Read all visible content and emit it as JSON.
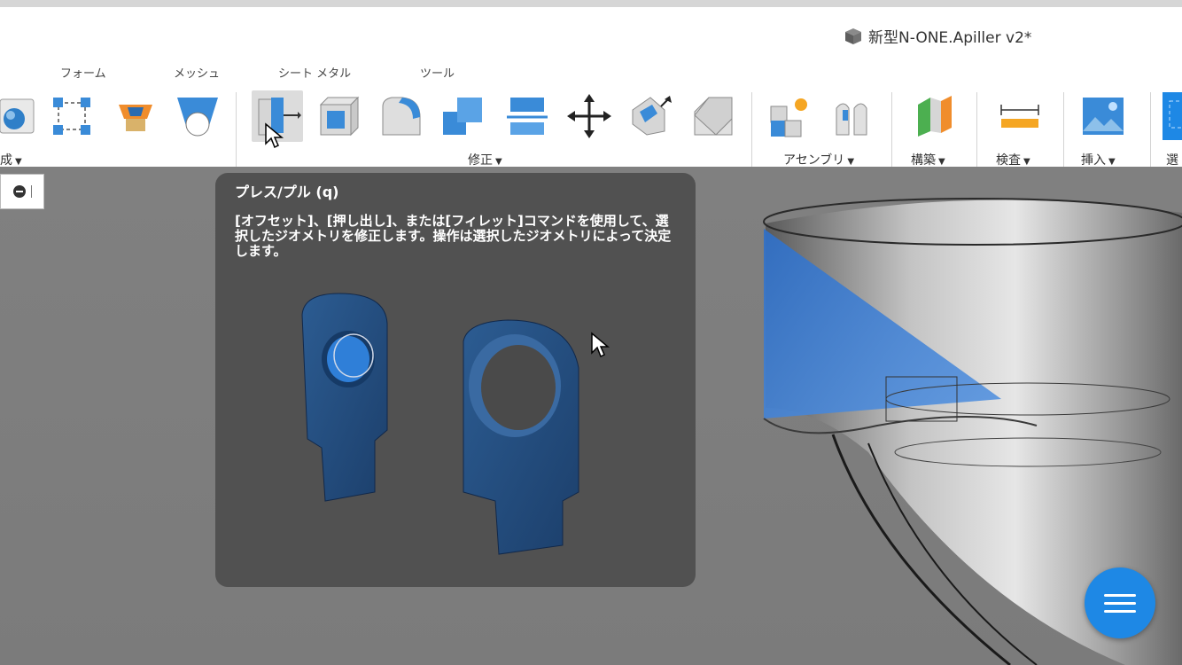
{
  "title_bar": {
    "document_title": "新型N-ONE.Apiller v2*",
    "document_icon": "cube-icon"
  },
  "tabs": [
    "フォーム",
    "メッシュ",
    "シート メタル",
    "ツール"
  ],
  "groups": {
    "create": "成",
    "modify": "修正",
    "assemble": "アセンブリ",
    "construct": "構築",
    "inspect": "検査",
    "insert": "挿入",
    "select": "選"
  },
  "toolbar_icons": {
    "create": [
      "sphere-icon",
      "sketch-edit-icon",
      "form-box-icon",
      "mesh-icon"
    ],
    "modify": [
      "press-pull-icon",
      "shell-icon",
      "fillet-icon",
      "combine-icon",
      "split-body-icon",
      "move-icon",
      "scale-icon",
      "chamfer-icon"
    ],
    "assemble": [
      "new-component-icon",
      "joint-icon"
    ],
    "construct": [
      "plane-icon"
    ],
    "inspect": [
      "measure-icon"
    ],
    "insert": [
      "insert-image-icon"
    ]
  },
  "tooltip": {
    "title": "プレス/プル (q)",
    "description": "[オフセット]、[押し出し]、または[フィレット]コマンドを使用して、選択したジオメトリを修正します。操作は選択したジオメトリによって決定します。"
  },
  "colors": {
    "accent_blue": "#1e88e5",
    "tooltip_bg": "#515151",
    "viewport_bg": "#7d7d7d"
  }
}
